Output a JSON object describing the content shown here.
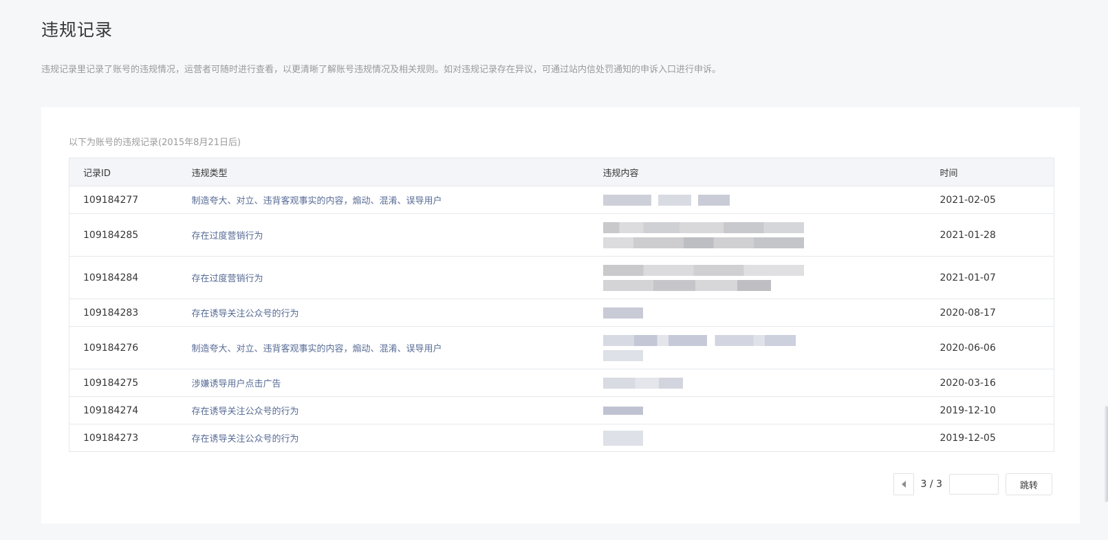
{
  "page": {
    "title": "违规记录",
    "description": "违规记录里记录了账号的违规情况，运营者可随时进行查看，以更清晰了解账号违规情况及相关规则。如对违规记录存在异议，可通过站内信处罚通知的申诉入口进行申诉。"
  },
  "table": {
    "caption": "以下为账号的违规记录(2015年8月21日后)",
    "headers": {
      "id": "记录ID",
      "type": "违规类型",
      "content": "违规内容",
      "time": "时间"
    },
    "rows": [
      {
        "id": "109184277",
        "type": "制造夸大、对立、违背客观事实的内容，煽动、混淆、误导用户",
        "time": "2021-02-05"
      },
      {
        "id": "109184285",
        "type": "存在过度营销行为",
        "time": "2021-01-28"
      },
      {
        "id": "109184284",
        "type": "存在过度营销行为",
        "time": "2021-01-07"
      },
      {
        "id": "109184283",
        "type": "存在诱导关注公众号的行为",
        "time": "2020-08-17"
      },
      {
        "id": "109184276",
        "type": "制造夸大、对立、违背客观事实的内容，煽动、混淆、误导用户",
        "time": "2020-06-06"
      },
      {
        "id": "109184275",
        "type": "涉嫌诱导用户点击广告",
        "time": "2020-03-16"
      },
      {
        "id": "109184274",
        "type": "存在诱导关注公众号的行为",
        "time": "2019-12-10"
      },
      {
        "id": "109184273",
        "type": "存在诱导关注公众号的行为",
        "time": "2019-12-05"
      }
    ]
  },
  "pagination": {
    "page_text": "3 / 3",
    "input_value": "",
    "jump_label": "跳转"
  },
  "colors": {
    "link": "#576b95",
    "text": "#353535",
    "muted": "#9a9a9a",
    "header_bg": "#f4f5f9",
    "border": "#e4e8eb"
  }
}
